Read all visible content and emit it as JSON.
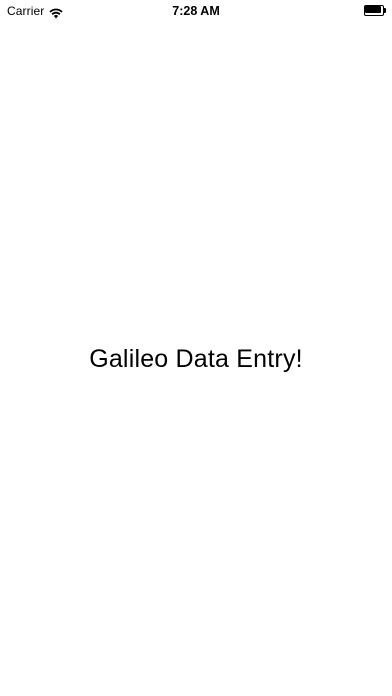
{
  "status_bar": {
    "carrier": "Carrier",
    "time": "7:28 AM",
    "icons": [
      "wifi-icon",
      "battery-icon"
    ],
    "battery_level": 1.0
  },
  "main": {
    "title": "Galileo Data Entry!"
  },
  "colors": {
    "background": "#ffffff",
    "text": "#000000"
  }
}
